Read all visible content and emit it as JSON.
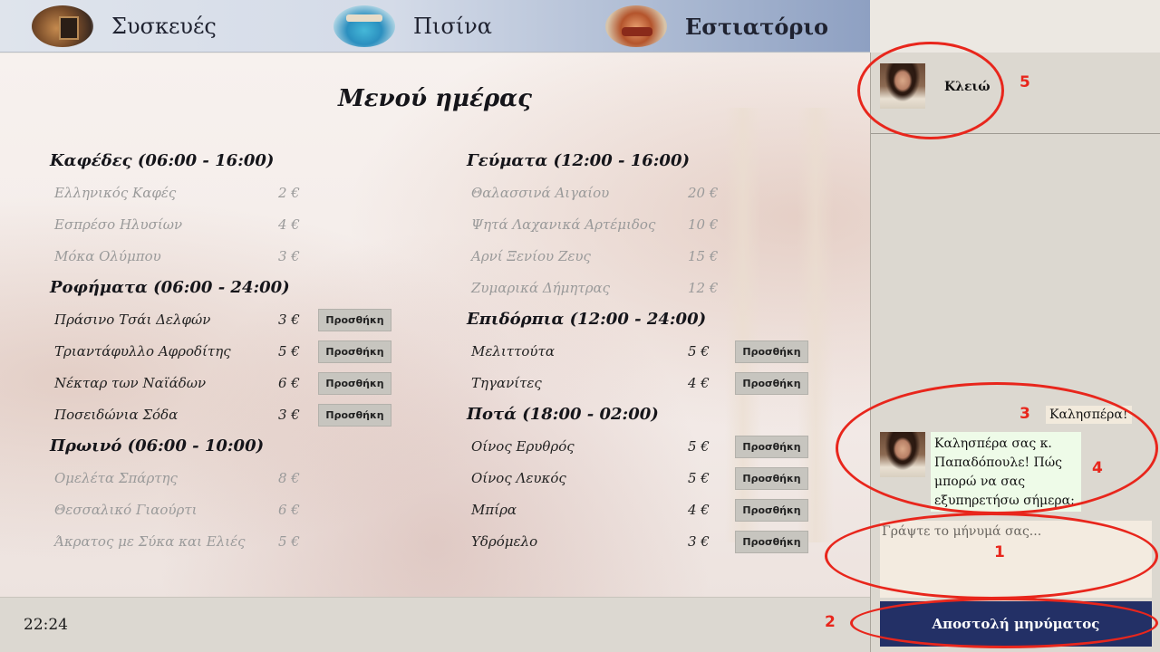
{
  "nav": {
    "items": [
      {
        "label": "Συσκευές",
        "icon": "appliances-thumb-icon"
      },
      {
        "label": "Πισίνα",
        "icon": "pool-thumb-icon"
      },
      {
        "label": "Εστιατόριο",
        "icon": "restaurant-thumb-icon",
        "active": true
      }
    ]
  },
  "menu": {
    "title": "Μενού ημέρας",
    "sections": [
      {
        "heading": "Καφέδες (06:00 - 16:00)",
        "available": false,
        "items": [
          {
            "name": "Ελληνικός Καφές",
            "price": "2 €"
          },
          {
            "name": "Εσπρέσο Ηλυσίων",
            "price": "4 €"
          },
          {
            "name": "Μόκα Ολύμπου",
            "price": "3 €"
          }
        ]
      },
      {
        "heading": "Ροφήματα (06:00 - 24:00)",
        "available": true,
        "items": [
          {
            "name": "Πράσινο Τσάι Δελφών",
            "price": "3 €"
          },
          {
            "name": "Τριαντάφυλλο Αφροδίτης",
            "price": "5 €"
          },
          {
            "name": "Νέκταρ των Ναϊάδων",
            "price": "6 €"
          },
          {
            "name": "Ποσειδώνια Σόδα",
            "price": "3 €"
          }
        ]
      },
      {
        "heading": "Πρωινό (06:00 - 10:00)",
        "available": false,
        "items": [
          {
            "name": "Ομελέτα Σπάρτης",
            "price": "8 €"
          },
          {
            "name": "Θεσσαλικό Γιαούρτι",
            "price": "6 €"
          },
          {
            "name": "Άκρατος με Σύκα και Ελιές",
            "price": "5 €"
          }
        ]
      },
      {
        "heading": "Γεύματα (12:00 - 16:00)",
        "available": false,
        "items": [
          {
            "name": "Θαλασσινά Αιγαίου",
            "price": "20 €"
          },
          {
            "name": "Ψητά Λαχανικά Αρτέμιδος",
            "price": "10 €"
          },
          {
            "name": "Αρνί Ξενίου Ζευς",
            "price": "15 €"
          },
          {
            "name": "Ζυμαρικά Δήμητρας",
            "price": "12 €"
          }
        ]
      },
      {
        "heading": "Επιδόρπια (12:00 - 24:00)",
        "available": true,
        "items": [
          {
            "name": "Μελιττούτα",
            "price": "5 €"
          },
          {
            "name": "Τηγανίτες",
            "price": "4 €"
          }
        ]
      },
      {
        "heading": "Ποτά (18:00 - 02:00)",
        "available": true,
        "items": [
          {
            "name": "Οίνος Ερυθρός",
            "price": "5 €"
          },
          {
            "name": "Οίνος Λευκός",
            "price": "5 €"
          },
          {
            "name": "Μπίρα",
            "price": "4 €"
          },
          {
            "name": "Υδρόμελο",
            "price": "3 €"
          }
        ]
      }
    ],
    "add_label": "Προσθήκη"
  },
  "status": {
    "time": "22:24"
  },
  "chat": {
    "agent_name": "Κλειώ",
    "messages": [
      {
        "from": "user",
        "text": "Καλησπέρα!"
      },
      {
        "from": "agent",
        "text": "Καλησπέρα σας κ. Παπαδόπουλε! Πώς μπορώ να σας εξυπηρετήσω σήμερα;"
      }
    ],
    "input_placeholder": "Γράψτε το μήνυμά σας...",
    "send_label": "Αποστολή μηνύματος"
  },
  "annotations": {
    "color": "#e8261c",
    "labels": [
      "1",
      "2",
      "3",
      "4",
      "5"
    ]
  }
}
